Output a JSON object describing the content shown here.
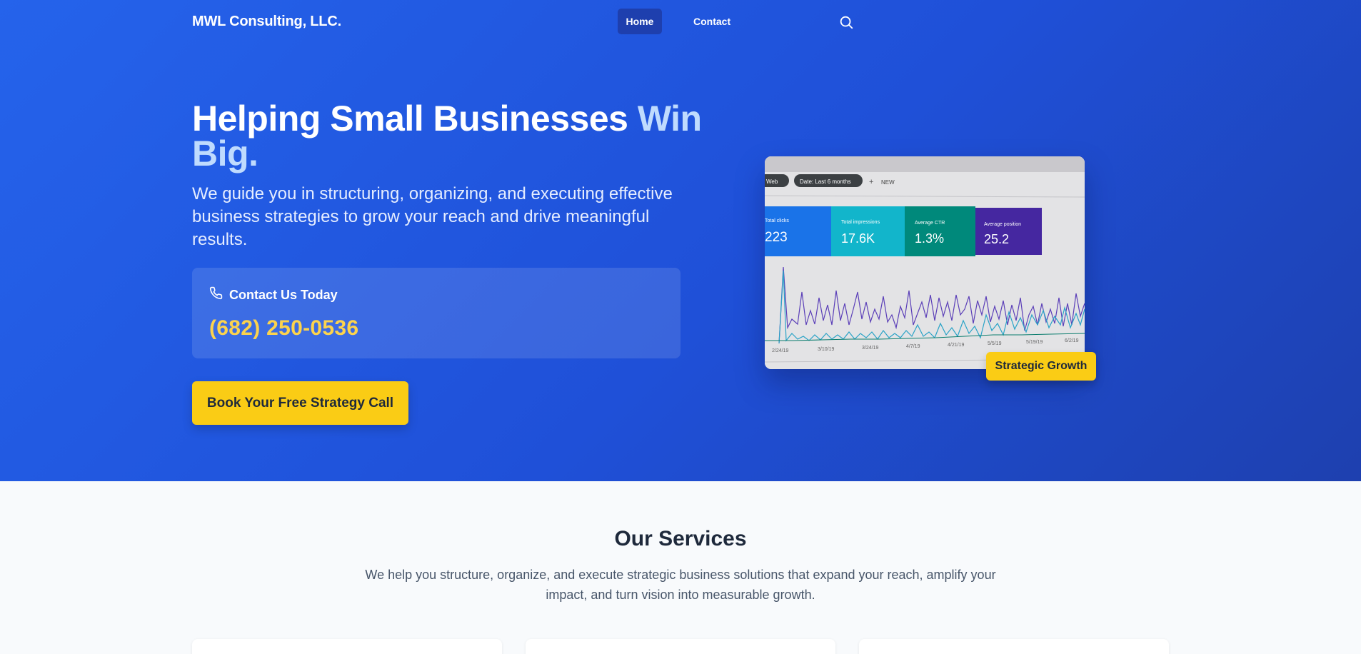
{
  "header": {
    "brand": "MWL Consulting, LLC.",
    "nav": {
      "home": "Home",
      "contact": "Contact"
    },
    "search_icon": "search-icon"
  },
  "hero": {
    "headline_main": "Helping Small Businesses ",
    "headline_accent": "Win Big.",
    "subtext": "We guide you in structuring, organizing, and executing effective business strategies to grow your reach and drive meaningful results.",
    "contact": {
      "icon": "phone-icon",
      "heading": "Contact Us Today",
      "phone": "(682) 250-0536"
    },
    "cta_label": "Book Your Free Strategy Call",
    "image_badge": "Strategic Growth",
    "dashboard": {
      "filters": [
        "Web",
        "Date: Last 6 months",
        "NEW"
      ],
      "metrics": [
        {
          "label": "Total clicks",
          "value": "223",
          "color": "#1a73e8"
        },
        {
          "label": "Total impressions",
          "value": "17.6K",
          "color": "#12b5cb"
        },
        {
          "label": "Average CTR",
          "value": "1.3%",
          "color": "#00897b"
        },
        {
          "label": "Average position",
          "value": "25.2",
          "color": "#4527a0"
        }
      ],
      "dates": [
        "2/24/19",
        "3/10/19",
        "3/24/19",
        "4/7/19",
        "4/21/19",
        "5/5/19",
        "5/19/19",
        "6/2/19"
      ]
    }
  },
  "services": {
    "title": "Our Services",
    "description": "We help you structure, organize, and execute strategic business solutions that expand your reach, amplify your impact, and turn vision into measurable growth."
  },
  "colors": {
    "hero_bg": "#2563eb",
    "accent_yellow": "#facc15",
    "phone_yellow": "#fcd34d",
    "headline_accent": "#bfdbfe"
  }
}
